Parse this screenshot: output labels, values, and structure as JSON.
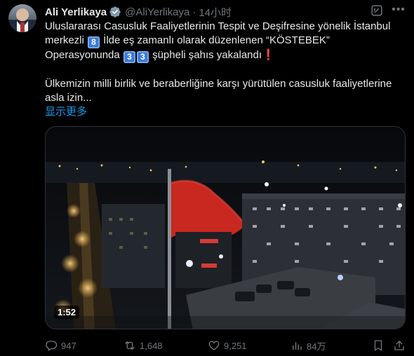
{
  "author": {
    "name": "Ali Yerlikaya",
    "handle": "@AliYerlikaya",
    "dot": "·",
    "time": "14小时"
  },
  "text": {
    "l1": "Uluslararası Casusluk Faaliyetlerinin Tespit ve Deşifresine yönelik İstanbul",
    "l2_a": "merkezli ",
    "k8": "8",
    "l2_b": " İlde eş zamanlı olarak düzenlenen “KÖSTEBEK”",
    "l3_a": "Operasyonunda ",
    "k3a": "3",
    "k3b": "3",
    "l3_b": " şüpheli şahıs yakalandı",
    "excl": "❗",
    "l4": "Ülkemizin milli birlik ve beraberliğine karşı yürütülen casusluk faaliyetlerine",
    "l5": "asla izin..."
  },
  "show_more": "显示更多",
  "video": {
    "duration": "1:52"
  },
  "actions": {
    "replies": "947",
    "reposts": "1,648",
    "likes": "9,251",
    "views": "84万"
  },
  "icons": {
    "verified": "verified-badge-icon",
    "grok": "grok-icon",
    "more": "more-options-icon",
    "reply": "reply-icon",
    "repost": "repost-icon",
    "like": "heart-icon",
    "views": "views-icon",
    "bookmark": "bookmark-icon",
    "share": "share-icon"
  },
  "colors": {
    "accent": "#1d9bf0",
    "muted": "#71767b",
    "text": "#e7e9ea",
    "background": "#000000"
  }
}
